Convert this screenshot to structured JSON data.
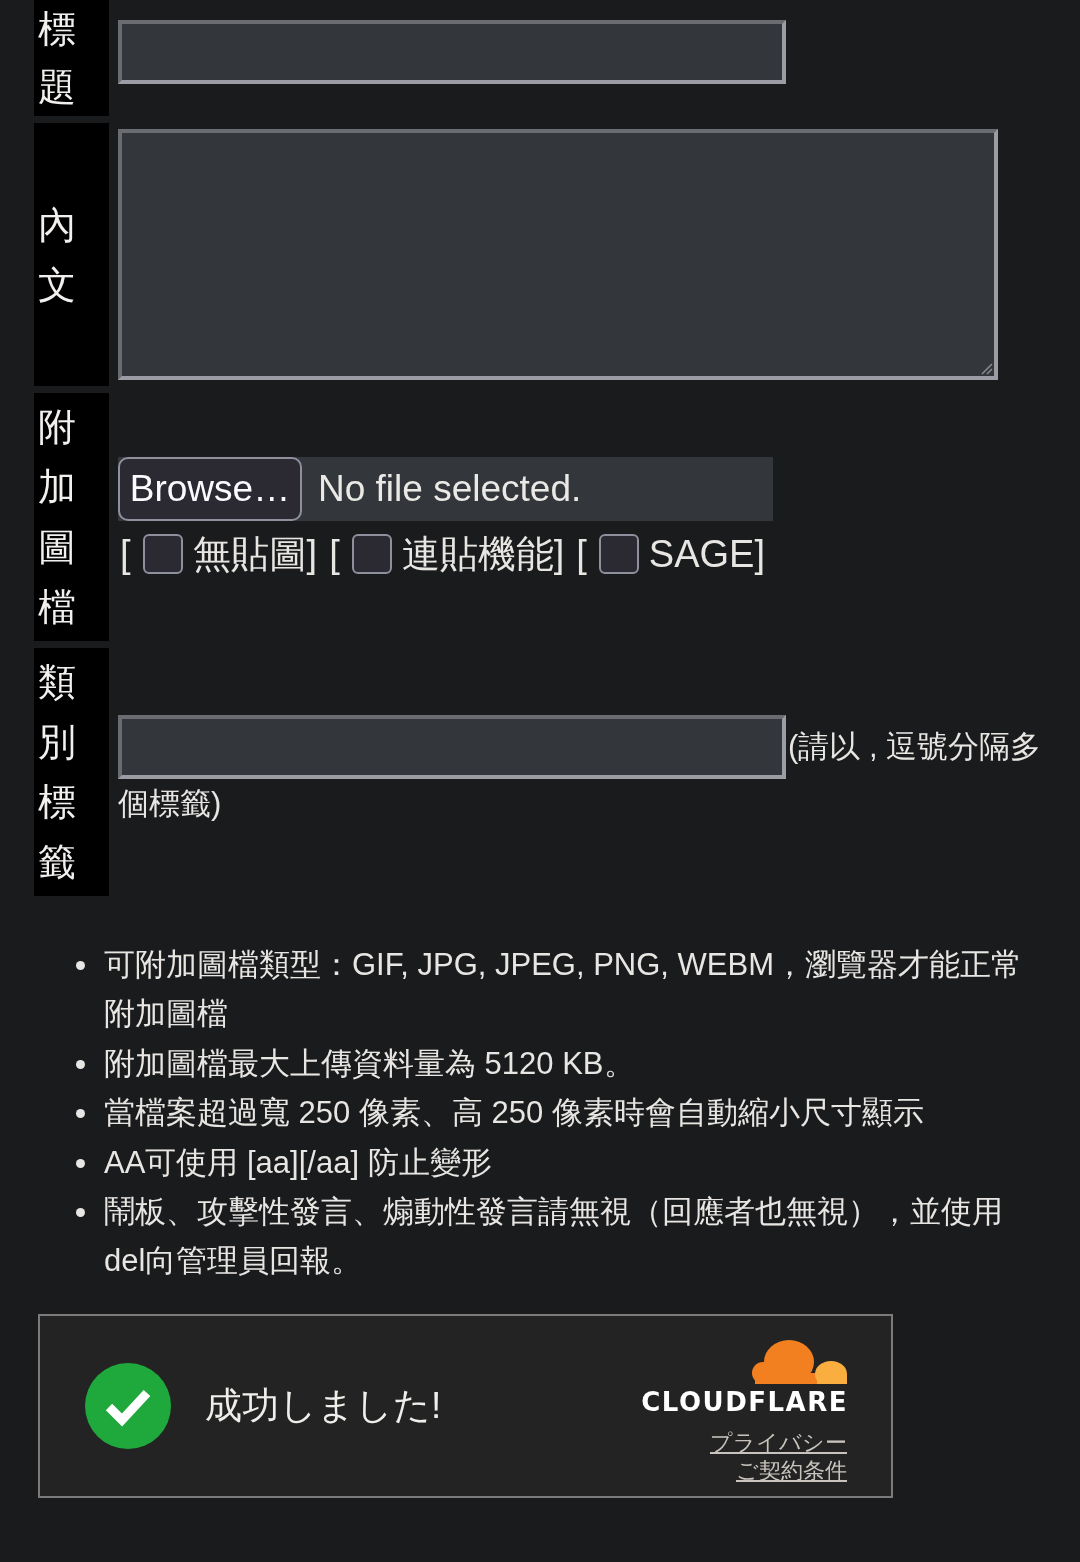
{
  "form": {
    "rows": [
      {
        "kind": "text",
        "label": "標題"
      },
      {
        "kind": "textarea",
        "label": "內文"
      },
      {
        "kind": "file",
        "label": "附加圖檔",
        "button": "Browse…",
        "status": "No file selected.",
        "options": [
          {
            "open": "[",
            "label": "無貼圖]",
            "checked": false
          },
          {
            "open": "[",
            "label": "連貼機能]",
            "checked": false
          },
          {
            "open": "[",
            "label": "SAGE]",
            "checked": false
          }
        ]
      },
      {
        "kind": "tags",
        "label": "類別標籤",
        "hint_lines": [
          "(請以 , 逗號分隔多",
          "個標籤)"
        ]
      }
    ]
  },
  "notes": [
    "可附加圖檔類型：GIF, JPG, JPEG, PNG, WEBM，瀏覽器才能正常附加圖檔",
    "附加圖檔最大上傳資料量為 5120 KB。",
    "當檔案超過寬 250 像素、高 250 像素時會自動縮小尺寸顯示",
    "AA可使用 [aa][/aa] 防止變形",
    "鬧板、攻擊性發言、煽動性發言請無視（回應者也無視），並使用del向管理員回報。"
  ],
  "captcha": {
    "status_text": "成功しました!",
    "brand": "CLOUDFLARE",
    "links": [
      "プライバシー",
      "ご契約条件"
    ]
  }
}
